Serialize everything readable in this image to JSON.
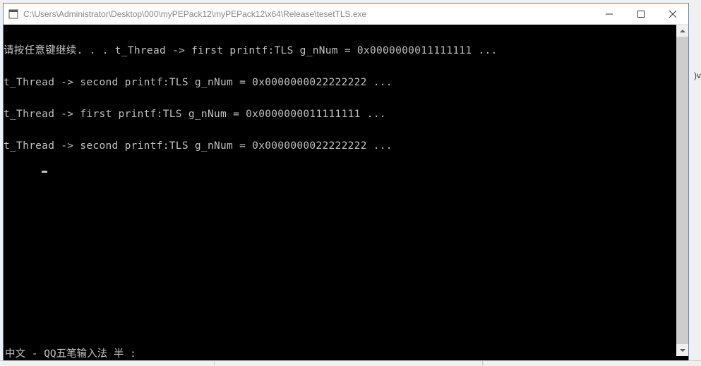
{
  "window": {
    "title": "C:\\Users\\Administrator\\Desktop\\000\\myPEPack12\\myPEPack12\\x64\\Release\\tesetTLS.exe"
  },
  "console": {
    "lines": [
      "请按任意键继续. . . t_Thread -> first printf:TLS g_nNum = 0x0000000011111111 ...",
      "t_Thread -> second printf:TLS g_nNum = 0x0000000022222222 ...",
      "t_Thread -> first printf:TLS g_nNum = 0x0000000011111111 ...",
      "t_Thread -> second printf:TLS g_nNum = 0x0000000022222222 ..."
    ],
    "ime_status": "中文 - QQ五笔输入法 半 :"
  },
  "bg": {
    "partial": ")v"
  }
}
